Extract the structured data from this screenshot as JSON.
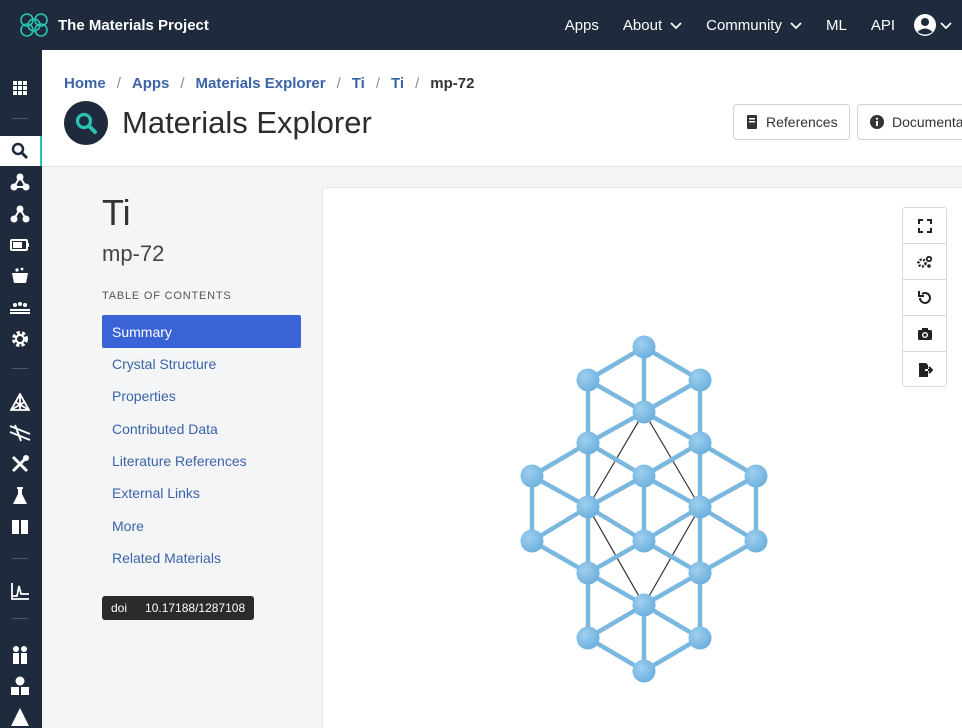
{
  "brand": {
    "name": "The Materials Project"
  },
  "nav": {
    "apps": "Apps",
    "about": "About",
    "community": "Community",
    "ml": "ML",
    "api": "API"
  },
  "breadcrumb": [
    "Home",
    "Apps",
    "Materials Explorer",
    "Ti",
    "Ti",
    "mp-72"
  ],
  "page": {
    "title": "Materials Explorer"
  },
  "header_buttons": {
    "references": "References",
    "documentation": "Documentation"
  },
  "material": {
    "formula": "Ti",
    "id": "mp-72"
  },
  "toc": {
    "heading": "TABLE OF CONTENTS",
    "items": [
      "Summary",
      "Crystal Structure",
      "Properties",
      "Contributed Data",
      "Literature References",
      "External Links",
      "More",
      "Related Materials"
    ],
    "active": "Summary"
  },
  "doi": {
    "label": "doi",
    "value": "10.17188/1287108"
  },
  "viewer_tools": [
    "fullscreen-icon",
    "settings-icon",
    "reset-icon",
    "camera-icon",
    "export-icon"
  ],
  "rail_icons": [
    "apps-grid-icon",
    "search-icon",
    "molecule-icon",
    "molecule-alt-icon",
    "battery-icon",
    "catalyst-icon",
    "surface-icon",
    "gear-icon",
    "phase-diagram-icon",
    "pourbaix-icon",
    "tools-icon",
    "flask-icon",
    "book-icon",
    "xas-icon",
    "synthesis-icon",
    "shapes-icon",
    "triangle-icon"
  ],
  "colors": {
    "navbar": "#1f2a3d",
    "link": "#3b63a8",
    "active_toc": "#3b63d8",
    "atom": "#6aaedd",
    "active_rail_accent": "#2ac4b3"
  }
}
